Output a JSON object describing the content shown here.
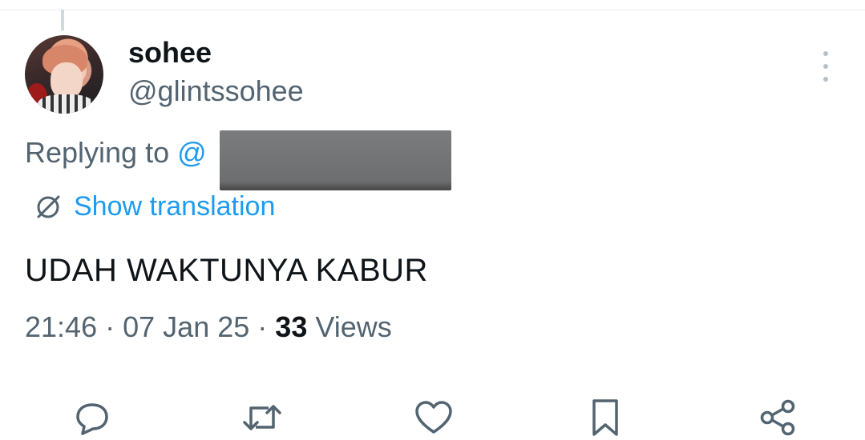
{
  "tweet": {
    "author": {
      "display_name": "sohee",
      "handle": "@glintssohee"
    },
    "replying_prefix": "Replying to",
    "replying_mention": "@",
    "translation_label": "Show translation",
    "text": "UDAH WAKTUNYA KABUR",
    "time": "21:46",
    "separator": "·",
    "date": "07 Jan 25",
    "views_count": "33",
    "views_label": "Views"
  },
  "icons": {
    "more": "more-vertical-icon",
    "translate": "globe-slash-icon",
    "reply": "reply-bubble-icon",
    "retweet": "retweet-icon",
    "like": "heart-icon",
    "bookmark": "bookmark-icon",
    "share": "share-icon"
  },
  "colors": {
    "accent": "#1d9bf0",
    "secondary_text": "#536471",
    "primary_text": "#0f1419"
  }
}
